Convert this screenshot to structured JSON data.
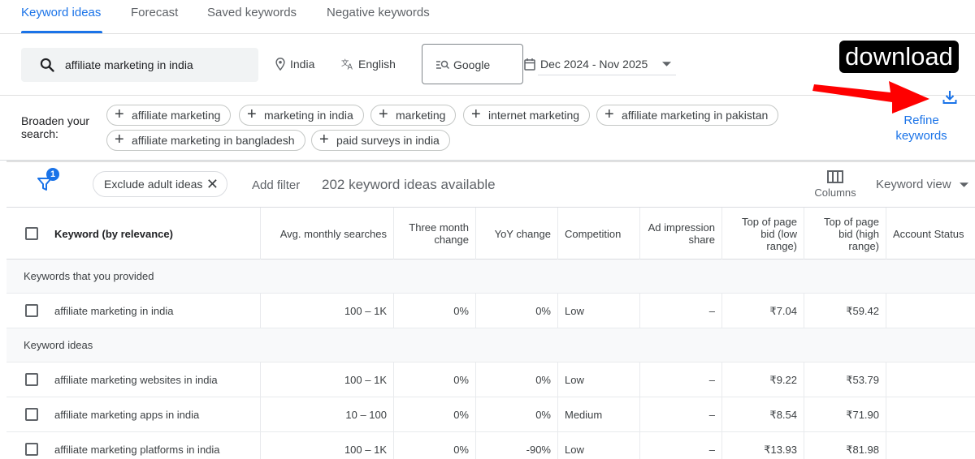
{
  "tabs": [
    "Keyword ideas",
    "Forecast",
    "Saved keywords",
    "Negative keywords"
  ],
  "search": {
    "query": "affiliate marketing in india",
    "location": "India",
    "language": "English",
    "network": "Google",
    "date_range": "Dec 2024 - Nov 2025"
  },
  "download_label": "download",
  "broaden": {
    "label": "Broaden your search:",
    "chips": [
      "affiliate marketing",
      "marketing in india",
      "marketing",
      "internet marketing",
      "affiliate marketing in pakistan",
      "affiliate marketing in bangladesh",
      "paid surveys in india"
    ],
    "refine": "Refine keywords"
  },
  "filter_bar": {
    "badge": "1",
    "exclude_chip": "Exclude adult ideas",
    "add_filter": "Add filter",
    "count": "202 keyword ideas available",
    "columns": "Columns",
    "keyword_view": "Keyword view"
  },
  "table": {
    "headers": [
      "Keyword (by relevance)",
      "Avg. monthly searches",
      "Three month change",
      "YoY change",
      "Competition",
      "Ad impression share",
      "Top of page bid (low range)",
      "Top of page bid (high range)",
      "Account Status"
    ],
    "section_provided": "Keywords that you provided",
    "provided_rows": [
      [
        "affiliate marketing in india",
        "100 – 1K",
        "0%",
        "0%",
        "Low",
        "–",
        "₹7.04",
        "₹59.42",
        ""
      ]
    ],
    "section_ideas": "Keyword ideas",
    "idea_rows": [
      [
        "affiliate marketing websites in india",
        "100 – 1K",
        "0%",
        "0%",
        "Low",
        "–",
        "₹9.22",
        "₹53.79",
        ""
      ],
      [
        "affiliate marketing apps in india",
        "10 – 100",
        "0%",
        "0%",
        "Medium",
        "–",
        "₹8.54",
        "₹71.90",
        ""
      ],
      [
        "affiliate marketing platforms in india",
        "100 – 1K",
        "0%",
        "-90%",
        "Low",
        "–",
        "₹13.93",
        "₹81.98",
        ""
      ]
    ]
  },
  "colors": {
    "accent": "#1a73e8",
    "arrow": "#ff0000"
  }
}
